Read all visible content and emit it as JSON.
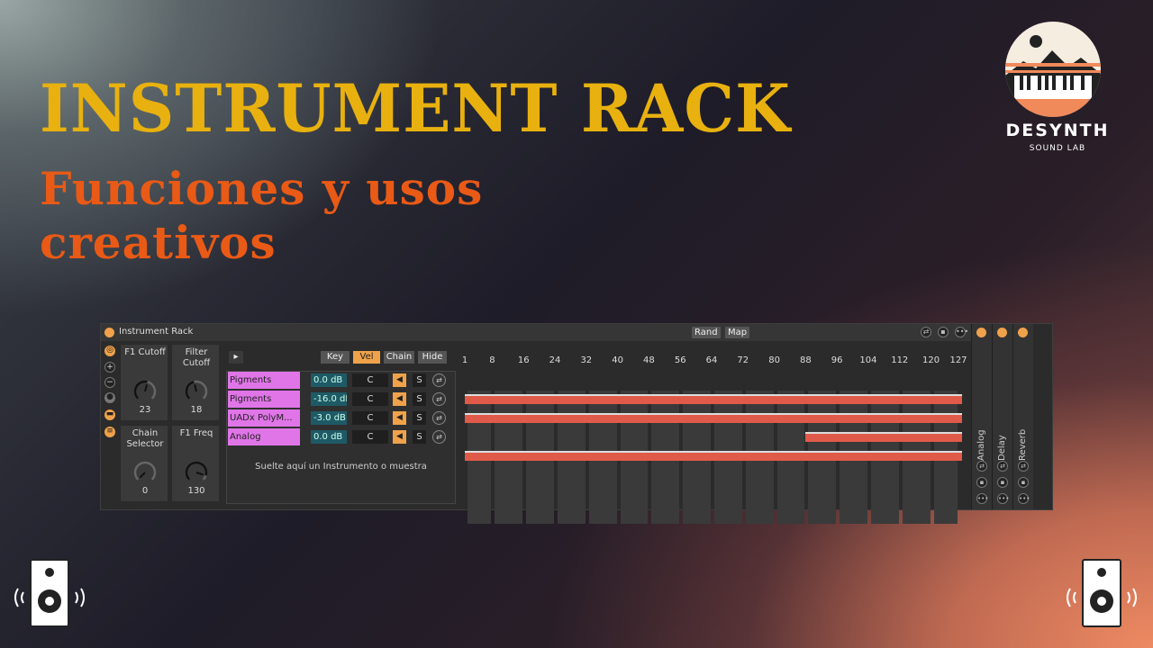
{
  "hero": {
    "title": "INSTRUMENT RACK",
    "subtitle": "Funciones y usos creativos"
  },
  "logo": {
    "name": "DESYNTH",
    "tagline": "SOUND LAB"
  },
  "colors": {
    "title": "#e8b10f",
    "subtitle": "#e95a16",
    "accent": "#f0a24a",
    "chain": "#e075e8",
    "zone": "#e05a4a"
  },
  "rack": {
    "title": "Instrument Rack",
    "rand_label": "Rand",
    "map_label": "Map",
    "icons": [
      "hot-swap-icon",
      "save-icon",
      "more-icon"
    ],
    "macros": [
      {
        "label": "F1 Cutoff",
        "value": "23",
        "level": 0.55
      },
      {
        "label": "Filter Cutoff",
        "value": "18",
        "level": 0.45
      },
      {
        "label": "Chain Selector",
        "value": "0",
        "level": 0.0
      },
      {
        "label": "F1 Freq",
        "value": "130",
        "level": 0.9
      }
    ],
    "tabs": {
      "key": "Key",
      "vel": "Vel",
      "chain": "Chain",
      "hide": "Hide",
      "active": "Vel"
    },
    "ruler": [
      "1",
      "8",
      "16",
      "24",
      "32",
      "40",
      "48",
      "56",
      "64",
      "72",
      "80",
      "88",
      "96",
      "104",
      "112",
      "120",
      "127"
    ],
    "chains": [
      {
        "name": "Pigments",
        "volume": "0.0 dB",
        "pan": "C",
        "solo": "S",
        "velocity_range": [
          1,
          127
        ]
      },
      {
        "name": "Pigments",
        "volume": "-16.0 dB",
        "pan": "C",
        "solo": "S",
        "velocity_range": [
          1,
          127
        ]
      },
      {
        "name": "UADx PolyM...",
        "volume": "-3.0 dB",
        "pan": "C",
        "solo": "S",
        "velocity_range": [
          88,
          127
        ]
      },
      {
        "name": "Analog",
        "volume": "0.0 dB",
        "pan": "C",
        "solo": "S",
        "velocity_range": [
          1,
          127
        ]
      }
    ],
    "drop_hint": "Suelte aquí un Instrumento o muestra"
  },
  "returns": [
    {
      "name": "Analog"
    },
    {
      "name": "Delay"
    },
    {
      "name": "Reverb"
    }
  ]
}
